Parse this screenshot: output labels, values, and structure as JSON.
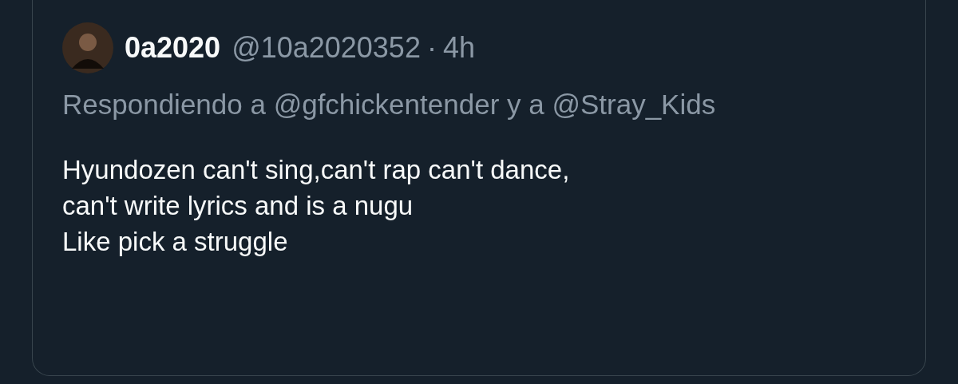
{
  "tweet": {
    "display_name": "0a2020",
    "handle": "@10a2020352",
    "separator": "·",
    "time": "4h",
    "reply_context": "Respondiendo a @gfchickentender y a @Stray_Kids",
    "text": "Hyundozen can't sing,can't rap can't dance,\ncan't write lyrics and is a nugu\nLike pick a struggle"
  }
}
